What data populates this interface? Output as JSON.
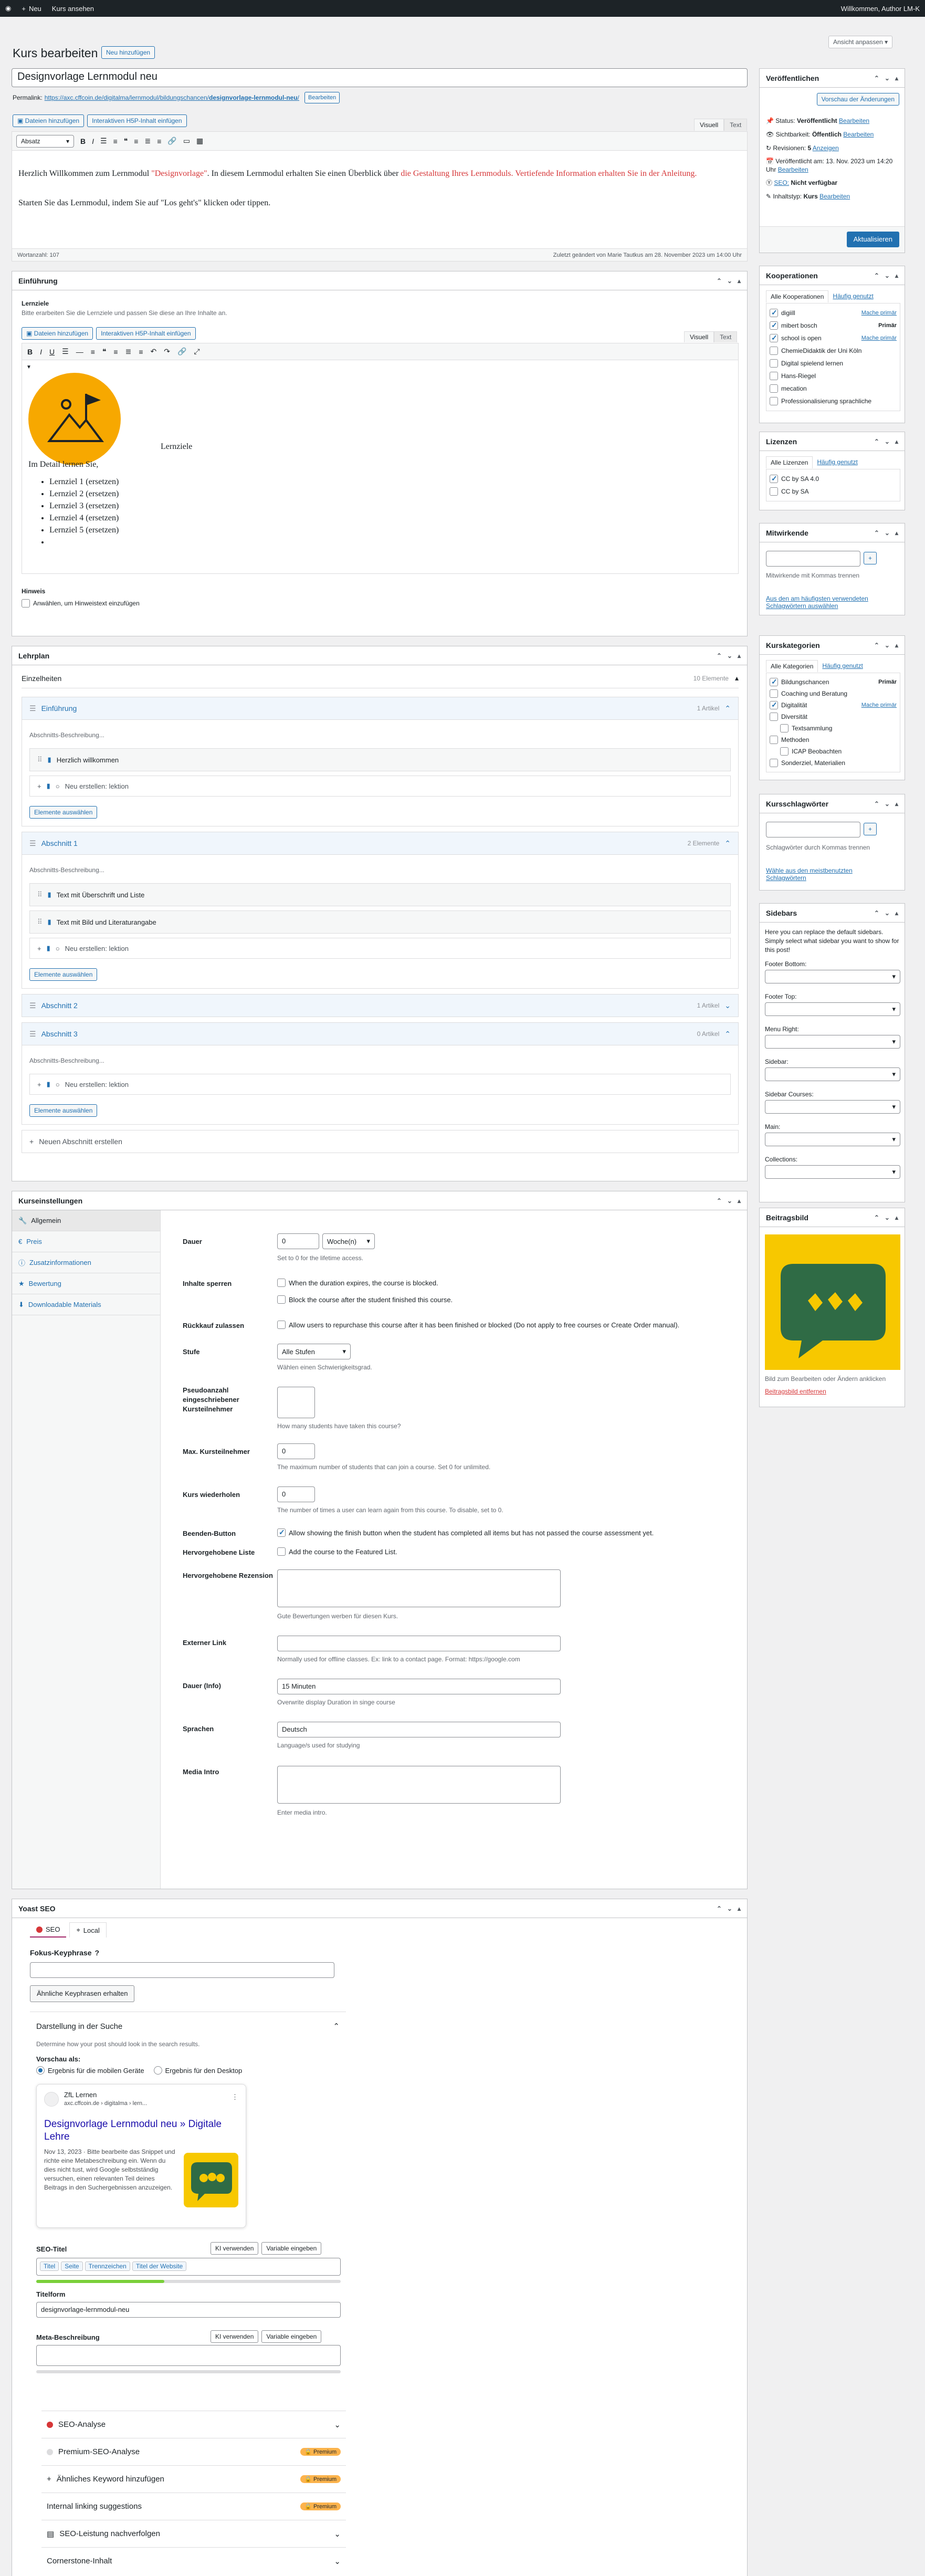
{
  "adminbar": {
    "new": "Neu",
    "view_course": "Kurs ansehen",
    "greeting": "Willkommen, Author LM-K"
  },
  "screen_options": "Ansicht anpassen",
  "page": {
    "title": "Kurs bearbeiten",
    "add_new": "Neu hinzufügen"
  },
  "post_title": "Designvorlage Lernmodul neu",
  "permalink": {
    "label": "Permalink:",
    "url_prefix": "https://axc.cffcoin.de/digitalma/lernmodul/bildungschancen/",
    "slug": "designvorlage-lernmodul-neu",
    "url_suffix": "/",
    "edit": "Bearbeiten"
  },
  "editor": {
    "add_files": "Dateien hinzufügen",
    "add_h5p": "Interaktiven H5P-Inhalt einfügen",
    "tab_visual": "Visuell",
    "tab_text": "Text",
    "format_select": "Absatz",
    "p1_a": "Herzlich Willkommen zum Lernmodul ",
    "p1_b": "\"Designvorlage\"",
    "p1_c": ". In diesem Lernmodul erhalten Sie einen Überblick über ",
    "p1_d": "die Gestaltung Ihres Lernmoduls. Vertiefende Information erhalten Sie in der Anleitung.",
    "p2": "Starten Sie das Lernmodul, indem Sie auf \"Los geht's\" klicken oder tippen.",
    "word_count": "Wortanzahl: 107",
    "last_edited": "Zuletzt geändert von Marie Tautkus am 28. November 2023 um 14:00 Uhr"
  },
  "intro_box": {
    "title": "Einführung",
    "field_label": "Lernziele",
    "field_desc": "Bitte erarbeiten Sie die Lernziele und passen Sie diese an Ihre Inhalte an.",
    "add_files": "Dateien hinzufügen",
    "add_h5p": "Interaktiven H5P-Inhalt einfügen",
    "tab_visual": "Visuell",
    "tab_text": "Text",
    "caption": "Lernziele",
    "detail": "Im Detail lernen Sie,",
    "goals": [
      "Lernziel 1 (ersetzen)",
      "Lernziel 2 (ersetzen)",
      "Lernziel 3 (ersetzen)",
      "Lernziel 4 (ersetzen)",
      "Lernziel 5 (ersetzen)"
    ],
    "hint_label": "Hinweis",
    "hint_check": "Anwählen, um Hinweistext einzufügen"
  },
  "curriculum": {
    "title": "Lehrplan",
    "heading": "Einzelheiten",
    "count": "10 Elemente",
    "section_desc": "Abschnitts-Beschreibung...",
    "new_lesson": "Neu erstellen: lektion",
    "select_items": "Elemente auswählen",
    "new_section": "Neuen Abschnitt erstellen",
    "sections": [
      {
        "name": "Einführung",
        "count": "1 Artikel",
        "items": [
          "Herzlich willkommen"
        ]
      },
      {
        "name": "Abschnitt 1",
        "count": "2 Elemente",
        "items": [
          "Text mit Überschrift und Liste",
          "Text mit Bild und Literaturangabe"
        ]
      },
      {
        "name": "Abschnitt 2",
        "count": "1 Artikel"
      },
      {
        "name": "Abschnitt 3",
        "count": "0 Artikel"
      }
    ]
  },
  "course_settings": {
    "title": "Kurseinstellungen",
    "tabs": [
      "Allgemein",
      "Preis",
      "Zusatzinformationen",
      "Bewertung",
      "Downloadable Materials"
    ],
    "duration": {
      "label": "Dauer",
      "value": "0",
      "unit": "Woche(n)",
      "desc": "Set to 0 for the lifetime access."
    },
    "block": {
      "label": "Inhalte sperren",
      "opt1": "When the duration expires, the course is blocked.",
      "opt2": "Block the course after the student finished this course."
    },
    "repurchase": {
      "label": "Rückkauf zulassen",
      "opt": "Allow users to repurchase this course after it has been finished or blocked (Do not apply to free courses or Create Order manual)."
    },
    "level": {
      "label": "Stufe",
      "value": "Alle Stufen",
      "desc": "Wählen einen Schwierigkeitsgrad."
    },
    "fake_students": {
      "label": "Pseudoanzahl eingeschriebener Kursteilnehmer",
      "value": "",
      "desc": "How many students have taken this course?"
    },
    "max_students": {
      "label": "Max. Kursteilnehmer",
      "value": "0",
      "desc": "The maximum number of students that can join a course. Set 0 for unlimited."
    },
    "retake": {
      "label": "Kurs wiederholen",
      "value": "0",
      "desc": "The number of times a user can learn again from this course. To disable, set to 0."
    },
    "finish_button": {
      "label": "Beenden-Button",
      "opt": "Allow showing the finish button when the student has completed all items but has not passed the course assessment yet."
    },
    "featured": {
      "label": "Hervorgehobene Liste",
      "opt": "Add the course to the Featured List."
    },
    "featured_review": {
      "label": "Hervorgehobene Rezension",
      "desc": "Gute Bewertungen werben für diesen Kurs."
    },
    "external_link": {
      "label": "Externer Link",
      "desc": "Normally used for offline classes. Ex: link to a contact page. Format: https://google.com"
    },
    "duration_info": {
      "label": "Dauer (Info)",
      "value": "15 Minuten",
      "desc": "Overwrite display Duration in singe course"
    },
    "languages": {
      "label": "Sprachen",
      "value": "Deutsch",
      "desc": "Language/s used for studying"
    },
    "media_intro": {
      "label": "Media Intro",
      "desc": "Enter media intro."
    }
  },
  "yoast": {
    "title": "Yoast SEO",
    "tab_seo": "SEO",
    "tab_local": "Local",
    "focus_label": "Fokus-Keyphrase",
    "similar_btn": "Ähnliche Keyphrasen erhalten",
    "search_appearance": "Darstellung in der Suche",
    "search_desc": "Determine how your post should look in the search results.",
    "preview_as": "Vorschau als:",
    "mobile": "Ergebnis für die mobilen Geräte",
    "desktop": "Ergebnis für den Desktop",
    "snippet": {
      "site": "ZfL Lernen",
      "url": "axc.cffcoin.de › digitalma › lern...",
      "title": "Designvorlage Lernmodul neu » Digitale Lehre",
      "date": "Nov 13, 2023",
      "text": "Bitte bearbeite das Snippet und richte eine Metabeschreibung ein. Wenn du dies nicht tust, wird Google selbstständig versuchen, einen relevanten Teil deines Beitrags in den Suchergebnissen anzuzeigen."
    },
    "seo_title_label": "SEO-Titel",
    "ai_btn": "KI verwenden",
    "var_btn": "Variable eingeben",
    "title_tags": [
      "Titel",
      "Seite",
      "Trennzeichen",
      "Titel der Website"
    ],
    "slug_label": "Titelform",
    "slug_value": "designvorlage-lernmodul-neu",
    "meta_label": "Meta-Beschreibung",
    "rows": [
      "SEO-Analyse",
      "Premium-SEO-Analyse",
      "Ähnliches Keyword hinzufügen",
      "Internal linking suggestions",
      "SEO-Leistung nachverfolgen",
      "Cornerstone-Inhalt"
    ],
    "premium": "Premium"
  },
  "publish": {
    "title": "Veröffentlichen",
    "preview": "Vorschau der Änderungen",
    "status_label": "Status:",
    "status": "Veröffentlicht",
    "visibility_label": "Sichtbarkeit:",
    "visibility": "Öffentlich",
    "revisions_label": "Revisionen:",
    "revisions": "5",
    "published_label": "Veröffentlicht am: 13. Nov. 2023 um 14:20 Uhr",
    "seo_label": "SEO:",
    "seo_value": "Nicht verfügbar",
    "type_label": "Inhaltstyp:",
    "type_value": "Kurs",
    "edit": "Bearbeiten",
    "show": "Anzeigen",
    "update": "Aktualisieren"
  },
  "cooperations": {
    "title": "Kooperationen",
    "tab_all": "Alle Kooperationen",
    "tab_frequent": "Häufig genutzt",
    "make_primary": "Mache primär",
    "primary": "Primär",
    "items": [
      {
        "name": "digiill",
        "checked": true,
        "primary": "make"
      },
      {
        "name": "mibert bosch",
        "checked": true,
        "primary": "yes"
      },
      {
        "name": "school is open",
        "checked": true,
        "primary": "make"
      },
      {
        "name": "ChemieDidaktik der Uni Köln",
        "checked": false
      },
      {
        "name": "Digital spielend lernen",
        "checked": false
      },
      {
        "name": "Hans-Riegel",
        "checked": false
      },
      {
        "name": "mecation",
        "checked": false
      },
      {
        "name": "Professionalisierung sprachliche",
        "checked": false
      }
    ]
  },
  "licenses": {
    "title": "Lizenzen",
    "tab_all": "Alle Lizenzen",
    "tab_frequent": "Häufig genutzt",
    "items": [
      {
        "name": "CC by SA 4.0",
        "checked": true
      },
      {
        "name": "CC by SA",
        "checked": false
      }
    ]
  },
  "contributors": {
    "title": "Mitwirkende",
    "add": "+",
    "desc": "Mitwirkende mit Kommas trennen",
    "link": "Aus den am häufigsten verwendeten Schlagwörtern auswählen"
  },
  "categories": {
    "title": "Kurskategorien",
    "tab_all": "Alle Kategorien",
    "tab_frequent": "Häufig genutzt",
    "primary": "Primär",
    "make_primary": "Mache primär",
    "items": [
      {
        "name": "Bildungschancen",
        "checked": true,
        "primary": "yes",
        "level": 0
      },
      {
        "name": "Coaching und Beratung",
        "checked": false,
        "level": 0
      },
      {
        "name": "Digitalität",
        "checked": true,
        "primary": "make",
        "level": 0
      },
      {
        "name": "Diversität",
        "checked": false,
        "level": 0
      },
      {
        "name": "Textsammlung",
        "checked": false,
        "level": 1
      },
      {
        "name": "Methoden",
        "checked": false,
        "level": 0
      },
      {
        "name": "ICAP Beobachten",
        "checked": false,
        "level": 1
      },
      {
        "name": "Sonderziel, Materialien",
        "checked": false,
        "level": 0
      }
    ]
  },
  "tags": {
    "title": "Kursschlagwörter",
    "add": "+",
    "desc": "Schlagwörter durch Kommas trennen",
    "link": "Wähle aus den meistbenutzten Schlagwörtern"
  },
  "sidebars": {
    "title": "Sidebars",
    "desc": "Here you can replace the default sidebars. Simply select what sidebar you want to show for this post!",
    "fields": [
      "Footer Bottom:",
      "Footer Top:",
      "Menu Right:",
      "Sidebar:",
      "Sidebar Courses:",
      "Main:",
      "Collections:"
    ]
  },
  "featured_image": {
    "title": "Beitragsbild",
    "hint": "Bild zum Bearbeiten oder Ändern anklicken",
    "remove": "Beitragsbild entfernen"
  },
  "colors": {
    "accent": "#2271b1",
    "admin_bar": "#1d2327",
    "red_text": "#d63638",
    "yoast_pink": "#a4286a",
    "image_yellow": "#f7c800",
    "image_green": "#2f6b45"
  }
}
